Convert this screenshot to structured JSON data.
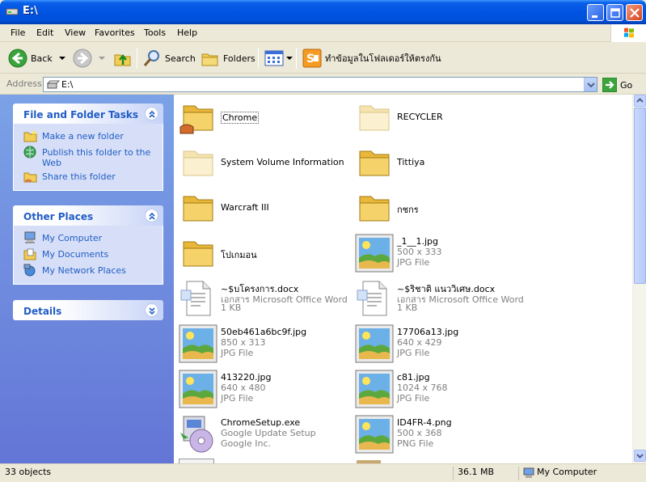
{
  "window": {
    "title": "E:\\"
  },
  "menu": [
    "File",
    "Edit",
    "View",
    "Favorites",
    "Tools",
    "Help"
  ],
  "toolbar": {
    "back": "Back",
    "search": "Search",
    "folders": "Folders",
    "custom": "ทำข้อมูลในโฟลเดอร์ให้ตรงกัน"
  },
  "address": {
    "label": "Address",
    "value": "E:\\",
    "go": "Go"
  },
  "tasks": {
    "title": "File and Folder Tasks",
    "items": [
      "Make a new folder",
      "Publish this folder to the Web",
      "Share this folder"
    ]
  },
  "places": {
    "title": "Other Places",
    "items": [
      "My Computer",
      "My Documents",
      "My Network Places"
    ]
  },
  "details": {
    "title": "Details"
  },
  "files": [
    {
      "name": "Chrome",
      "kind": "folder-shared"
    },
    {
      "name": "RECYCLER",
      "kind": "folder-faded"
    },
    {
      "name": "System Volume Information",
      "kind": "folder-faded"
    },
    {
      "name": "Tittiya",
      "kind": "folder"
    },
    {
      "name": "Warcraft III",
      "kind": "folder"
    },
    {
      "name": "กชกร",
      "kind": "folder"
    },
    {
      "name": "โปเกมอน",
      "kind": "folder"
    },
    {
      "name": "_1__1.jpg",
      "d1": "500 x 333",
      "d2": "JPG File",
      "kind": "image"
    },
    {
      "name": "~$บโครงการ.docx",
      "d1": "เอกสาร Microsoft Office Word",
      "d2": "1 KB",
      "kind": "doc"
    },
    {
      "name": "~$ริชาติ แนววิเศษ.docx",
      "d1": "เอกสาร Microsoft Office Word",
      "d2": "1 KB",
      "kind": "doc"
    },
    {
      "name": "50eb461a6bc9f.jpg",
      "d1": "850 x 313",
      "d2": "JPG File",
      "kind": "image"
    },
    {
      "name": "17706a13.jpg",
      "d1": "640 x 429",
      "d2": "JPG File",
      "kind": "image"
    },
    {
      "name": "413220.jpg",
      "d1": "640 x 480",
      "d2": "JPG File",
      "kind": "image"
    },
    {
      "name": "c81.jpg",
      "d1": "1024 x 768",
      "d2": "JPG File",
      "kind": "image"
    },
    {
      "name": "ChromeSetup.exe",
      "d1": "Google Update Setup",
      "d2": "Google Inc.",
      "kind": "exe"
    },
    {
      "name": "ID4FR-4.png",
      "d1": "500 x 368",
      "d2": "PNG File",
      "kind": "image"
    }
  ],
  "status": {
    "objects": "33 objects",
    "size": "36.1 MB",
    "location": "My Computer"
  },
  "colors": {
    "titlebar": "#0054E3",
    "taskpane": "#6D8AE0",
    "link": "#215DC6"
  }
}
